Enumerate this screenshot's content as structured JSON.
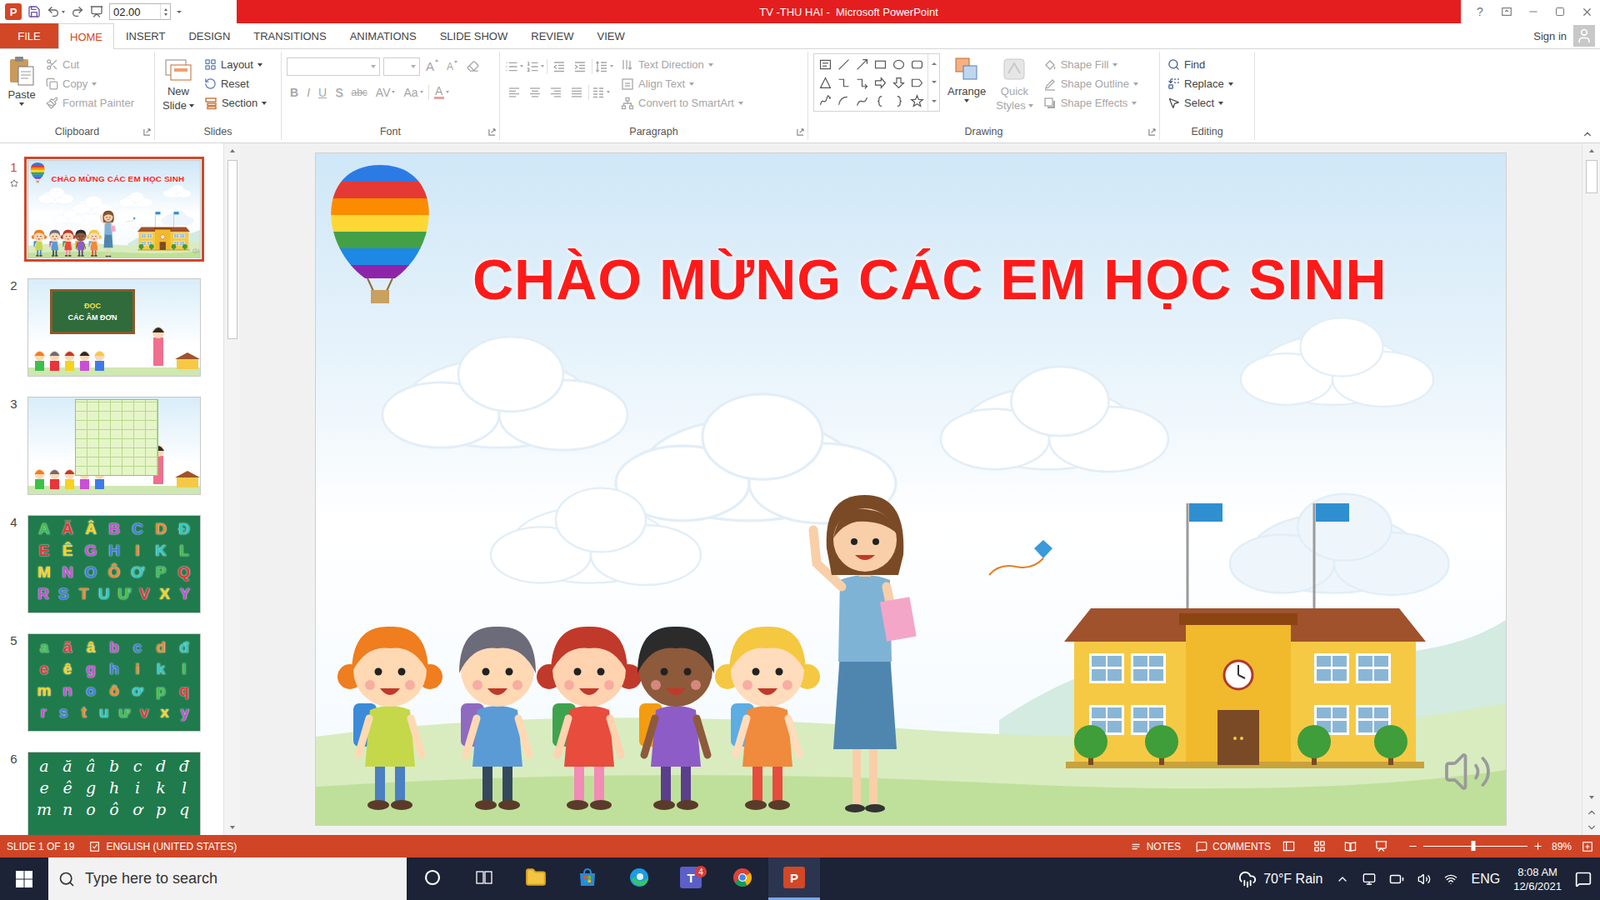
{
  "window": {
    "title": "TV -THU HAI -  Microsoft PowerPoint",
    "app_icon": "P",
    "help": "?"
  },
  "quick_access": {
    "field_value": "02.00"
  },
  "tabs": [
    {
      "label": "FILE",
      "kind": "file",
      "selected": false
    },
    {
      "label": "HOME",
      "kind": "tab",
      "selected": true
    },
    {
      "label": "INSERT",
      "kind": "tab",
      "selected": false
    },
    {
      "label": "DESIGN",
      "kind": "tab",
      "selected": false
    },
    {
      "label": "TRANSITIONS",
      "kind": "tab",
      "selected": false
    },
    {
      "label": "ANIMATIONS",
      "kind": "tab",
      "selected": false
    },
    {
      "label": "SLIDE SHOW",
      "kind": "tab",
      "selected": false
    },
    {
      "label": "REVIEW",
      "kind": "tab",
      "selected": false
    },
    {
      "label": "VIEW",
      "kind": "tab",
      "selected": false
    }
  ],
  "account": {
    "label": "Sign in"
  },
  "ribbon": {
    "clipboard": {
      "label": "Clipboard",
      "paste": {
        "label": "Paste",
        "disabled": false
      },
      "items": [
        {
          "label": "Cut",
          "kind": "cut",
          "disabled": true,
          "dropdown": false
        },
        {
          "label": "Copy",
          "kind": "copy",
          "disabled": true,
          "dropdown": true
        },
        {
          "label": "Format Painter",
          "kind": "painter",
          "disabled": true,
          "dropdown": false
        }
      ]
    },
    "slides": {
      "label": "Slides",
      "new_slide": {
        "lines": [
          "New",
          "Slide"
        ],
        "disabled": false
      },
      "items": [
        {
          "label": "Layout",
          "kind": "layout",
          "disabled": false,
          "dropdown": true
        },
        {
          "label": "Reset",
          "kind": "reset",
          "disabled": false,
          "dropdown": false
        },
        {
          "label": "Section",
          "kind": "section",
          "disabled": false,
          "dropdown": true
        }
      ]
    },
    "font": {
      "label": "Font",
      "disabled": true,
      "size_buttons": [
        {
          "label": "A",
          "kind": "grow"
        },
        {
          "label": "A",
          "kind": "shrink"
        }
      ],
      "format_buttons": [
        {
          "label": "B",
          "kind": "bold",
          "dropdown": false
        },
        {
          "label": "I",
          "kind": "italic",
          "dropdown": false
        },
        {
          "label": "U",
          "kind": "underline",
          "dropdown": false
        },
        {
          "label": "S",
          "kind": "shadow",
          "dropdown": false
        },
        {
          "label": "abc",
          "kind": "strike",
          "dropdown": false
        },
        {
          "label": "AV",
          "kind": "spacing",
          "dropdown": true
        },
        {
          "label": "Aa",
          "kind": "case",
          "dropdown": true
        },
        {
          "label": "A",
          "kind": "color",
          "dropdown": true
        }
      ]
    },
    "paragraph": {
      "label": "Paragraph",
      "disabled": true,
      "items": [
        {
          "label": "Text Direction",
          "kind": "text-direction",
          "dropdown": true
        },
        {
          "label": "Align Text",
          "kind": "align-text",
          "dropdown": true
        },
        {
          "label": "Convert to SmartArt",
          "kind": "smartart",
          "dropdown": true
        }
      ]
    },
    "drawing": {
      "label": "Drawing",
      "arrange": {
        "label": "Arrange",
        "disabled": false
      },
      "quick_styles": {
        "lines": [
          "Quick",
          "Styles"
        ],
        "disabled": true
      },
      "items": [
        {
          "label": "Shape Fill",
          "kind": "fill",
          "disabled": true,
          "dropdown": true
        },
        {
          "label": "Shape Outline",
          "kind": "outline",
          "disabled": true,
          "dropdown": true
        },
        {
          "label": "Shape Effects",
          "kind": "effects",
          "disabled": true,
          "dropdown": true
        }
      ]
    },
    "editing": {
      "label": "Editing",
      "items": [
        {
          "label": "Find",
          "kind": "find",
          "disabled": false,
          "dropdown": false
        },
        {
          "label": "Replace",
          "kind": "replace",
          "disabled": false,
          "dropdown": true
        },
        {
          "label": "Select",
          "kind": "select",
          "disabled": false,
          "dropdown": true
        }
      ]
    }
  },
  "thumbnails": [
    {
      "number": "1",
      "selected": true,
      "starred": true,
      "kind": "title",
      "lines": [
        "CHÀO MỪNG CÁC EM HỌC SINH"
      ]
    },
    {
      "number": "2",
      "selected": false,
      "starred": false,
      "kind": "board",
      "lines": [
        "ĐỌC",
        "CÁC ÂM ĐƠN"
      ]
    },
    {
      "number": "3",
      "selected": false,
      "starred": false,
      "kind": "picture",
      "lines": []
    },
    {
      "number": "4",
      "selected": false,
      "starred": false,
      "kind": "letters",
      "lines": [
        "A Ă Â B C D Đ",
        "E Ê G H I K L",
        "M N O Ô Ơ P Q",
        "R S T U Ư V X Y"
      ]
    },
    {
      "number": "5",
      "selected": false,
      "starred": false,
      "kind": "letters",
      "lines": [
        "a ă â b c d đ",
        "e ê g h i k l",
        "m n o ô ơ p q",
        "r s t u ư v x y"
      ]
    },
    {
      "number": "6",
      "selected": false,
      "starred": false,
      "kind": "cursive",
      "lines": [
        "a ă â b c d đ",
        "e ê g h i k l",
        "m n o ô ơ p q"
      ]
    }
  ],
  "slide": {
    "title": "CHÀO MỪNG CÁC EM HỌC SINH"
  },
  "status_bar": {
    "slide_indicator": "SLIDE 1 OF 19",
    "language": "ENGLISH (UNITED STATES)",
    "notes": "NOTES",
    "comments": "COMMENTS",
    "zoom": {
      "level": 0.48,
      "reading": "89%"
    }
  },
  "taskbar": {
    "search_placeholder": "Type here to search",
    "apps": [
      {
        "kind": "cortana",
        "active": false
      },
      {
        "kind": "task-view",
        "active": false
      },
      {
        "kind": "explorer",
        "active": false
      },
      {
        "kind": "store",
        "active": false
      },
      {
        "kind": "edge",
        "active": false
      },
      {
        "kind": "teams",
        "letter": "T",
        "badge": "4",
        "active": false
      },
      {
        "kind": "chrome",
        "active": false
      },
      {
        "kind": "powerpoint",
        "letter": "P",
        "active": true
      }
    ],
    "weather": "70°F Rain",
    "language": "ENG",
    "time": "8:08 AM",
    "date": "12/6/2021"
  }
}
